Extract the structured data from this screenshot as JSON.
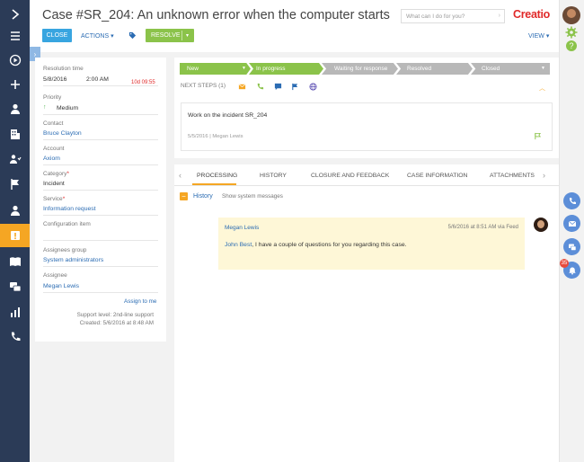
{
  "header": {
    "title": "Case #SR_204: An unknown error when the computer starts",
    "search_placeholder": "What can I do for you?",
    "logo": "Creatio",
    "close_label": "CLOSE",
    "actions_label": "ACTIONS",
    "resolve_label": "RESOLVE",
    "view_label": "VIEW"
  },
  "nav": {
    "icons": [
      "expand-icon",
      "menu-icon",
      "play-icon",
      "plus-icon",
      "person-icon",
      "building-icon",
      "contacts-icon",
      "flag-icon",
      "user-icon",
      "alert-icon",
      "book-icon",
      "chat-icon",
      "chart-icon",
      "phone-icon"
    ],
    "active_index": 9
  },
  "fields": {
    "resolution_time": {
      "label": "Resolution time",
      "date": "5/8/2016",
      "time": "2:00 AM",
      "overdue": "10d 09:55"
    },
    "priority": {
      "label": "Priority",
      "value": "Medium"
    },
    "contact": {
      "label": "Contact",
      "value": "Bruce Clayton"
    },
    "account": {
      "label": "Account",
      "value": "Axiom"
    },
    "category": {
      "label": "Category",
      "value": "Incident",
      "required_mark": "*"
    },
    "service": {
      "label": "Service",
      "value": "Information request",
      "required_mark": "*"
    },
    "configuration_item": {
      "label": "Configuration item",
      "value": ""
    },
    "assignees_group": {
      "label": "Assignees group",
      "value": "System administrators"
    },
    "assignee": {
      "label": "Assignee",
      "value": "Megan Lewis"
    },
    "assign_to_me": "Assign to me",
    "support_level": "Support level: 2nd-line support",
    "created": "Created: 5/6/2016 at 8:48 AM"
  },
  "stages": [
    {
      "label": "New",
      "state": "done"
    },
    {
      "label": "In progress",
      "state": "done"
    },
    {
      "label": "Waiting for response",
      "state": "todo"
    },
    {
      "label": "Resolved",
      "state": "todo"
    },
    {
      "label": "Closed",
      "state": "todo"
    }
  ],
  "next_steps": {
    "label": "NEXT STEPS (1)",
    "task_text": "Work on the incident SR_204",
    "task_date": "5/5/2016",
    "task_owner": "Megan Lewis"
  },
  "tabs": [
    {
      "label": "PROCESSING",
      "active": true
    },
    {
      "label": "HISTORY",
      "active": false
    },
    {
      "label": "CLOSURE AND FEEDBACK",
      "active": false
    },
    {
      "label": "CASE INFORMATION",
      "active": false
    },
    {
      "label": "ATTACHMENTS",
      "active": false
    }
  ],
  "history": {
    "toggle": "−",
    "label": "History",
    "show_system": "Show system messages",
    "message": {
      "author": "Megan Lewis",
      "meta": "5/6/2016 at 8:51 AM via Feed",
      "mention": "John Best",
      "text": ", I have a couple of questions for you regarding this case."
    }
  },
  "notifications": {
    "count": "35"
  },
  "colors": {
    "nav_bg": "#2b3b57",
    "accent": "#f5a623",
    "stage_done": "#8bc34a",
    "link": "#2b6cb3",
    "primary": "#38a5e0"
  }
}
